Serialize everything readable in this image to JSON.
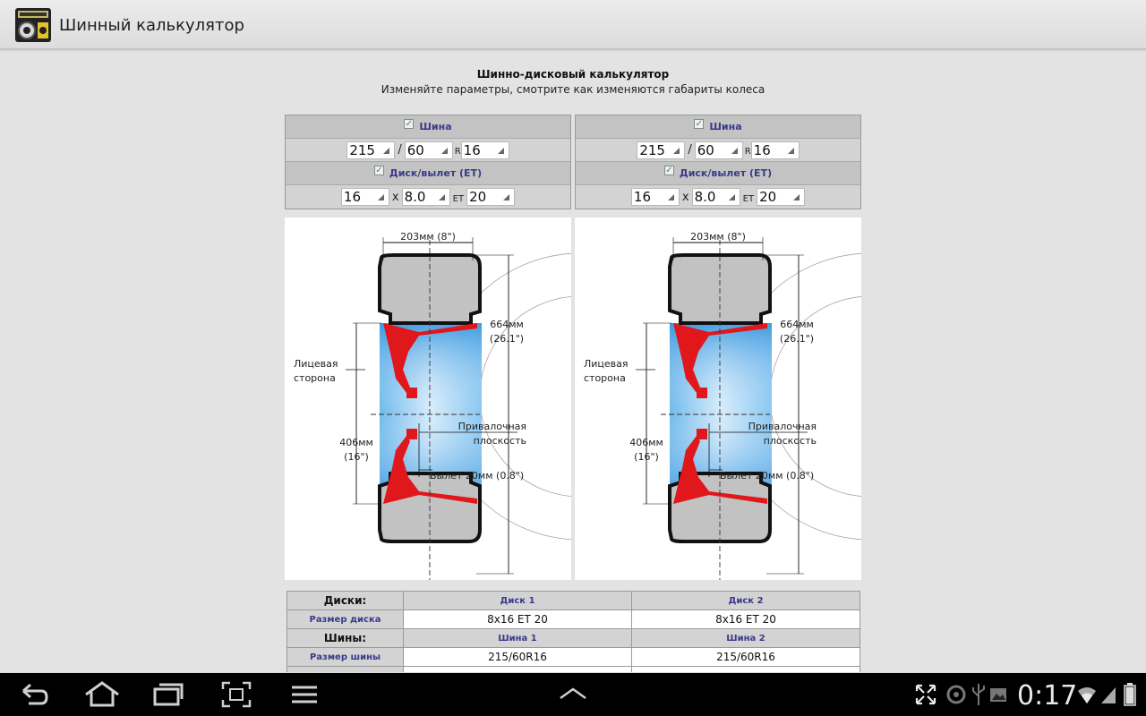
{
  "app": {
    "title": "Шинный калькулятор",
    "icon": "tyre-calculator-app-icon"
  },
  "page": {
    "heading": "Шинно-дисковый калькулятор",
    "subheading": "Изменяйте параметры, смотрите как изменяются габариты колеса"
  },
  "panels": [
    {
      "tire_label": "Шина",
      "tire_checked": true,
      "tire_width": "215",
      "tire_profile": "60",
      "slash": "/",
      "r_label": "R",
      "tire_radius": "16",
      "disk_label": "Диск/вылет (ET)",
      "disk_checked": true,
      "disk_diameter": "16",
      "x_label": "x",
      "disk_width": "8.0",
      "et_label": "ET",
      "disk_et": "20"
    },
    {
      "tire_label": "Шина",
      "tire_checked": true,
      "tire_width": "215",
      "tire_profile": "60",
      "slash": "/",
      "r_label": "R",
      "tire_radius": "16",
      "disk_label": "Диск/вылет (ET)",
      "disk_checked": true,
      "disk_diameter": "16",
      "x_label": "x",
      "disk_width": "8.0",
      "et_label": "ET",
      "disk_et": "20"
    }
  ],
  "diagrams": [
    {
      "width_label": "203мм (8\")",
      "outer_mm": "664мм",
      "outer_in": "(26.1\")",
      "face_line1": "Лицевая",
      "face_line2": "сторона",
      "mount_line1": "Привалочная",
      "mount_line2": "плоскость",
      "rim_mm": "406мм",
      "rim_in": "(16\")",
      "offset_label": "Вылет 20мм (0.8\")"
    },
    {
      "width_label": "203мм (8\")",
      "outer_mm": "664мм",
      "outer_in": "(26.1\")",
      "face_line1": "Лицевая",
      "face_line2": "сторона",
      "mount_line1": "Привалочная",
      "mount_line2": "плоскость",
      "rim_mm": "406мм",
      "rim_in": "(16\")",
      "offset_label": "Вылет 20мм (0.8\")"
    }
  ],
  "results": {
    "disks_header": "Диски:",
    "disk1_header": "Диск 1",
    "disk2_header": "Диск 2",
    "disk_size_label": "Размер диска",
    "disk1_size": "8x16 ET 20",
    "disk2_size": "8x16 ET 20",
    "tires_header": "Шины:",
    "tire1_header": "Шина 1",
    "tire2_header": "Шина 2",
    "tire_size_label": "Размер шины",
    "tire1_size": "215/60R16",
    "tire2_size": "215/60R16"
  },
  "system_bar": {
    "clock": "0:17",
    "nav_icons": [
      "back-icon",
      "home-icon",
      "recent-apps-icon",
      "screenshot-icon",
      "menu-icon",
      "chevron-up-icon"
    ],
    "status_icons": [
      "expand-icon",
      "sync-icon",
      "usb-icon",
      "image-icon",
      "wifi-icon",
      "signal-icon",
      "battery-icon"
    ]
  },
  "colors": {
    "rim_red": "#e0171b",
    "tire_gray": "#c2c2c2",
    "panel_header_text": "#3a3a8a",
    "wheel_blue": "#4aa7e8"
  }
}
